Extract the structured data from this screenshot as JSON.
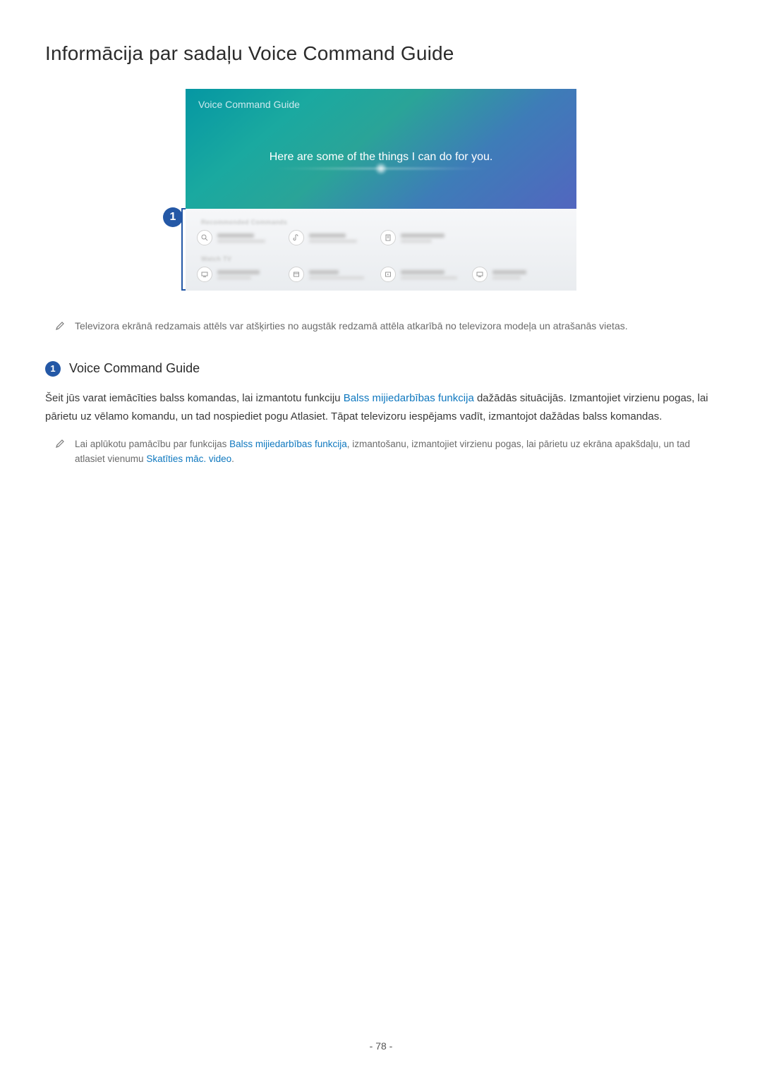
{
  "heading": "Informācija par sadaļu Voice Command Guide",
  "tv": {
    "title": "Voice Command Guide",
    "tagline": "Here are some of the things I can do for you.",
    "section1_label": "Recommended Commands",
    "section2_label": "Watch TV"
  },
  "callout": {
    "num": "1"
  },
  "note1": "Televizora ekrānā redzamais attēls var atšķirties no augstāk redzamā attēla atkarībā no televizora modeļa un atrašanās vietas.",
  "section": {
    "num": "1",
    "title": "Voice Command Guide"
  },
  "body": {
    "p1a": "Šeit jūs varat iemācīties balss komandas, lai izmantotu funkciju ",
    "p1_link": "Balss mijiedarbības funkcija",
    "p1b": " dažādās situācijās. Izmantojiet virzienu pogas, lai pārietu uz vēlamo komandu, un tad nospiediet pogu Atlasiet. Tāpat televizoru iespējams vadīt, izmantojot dažādas balss komandas."
  },
  "note2": {
    "a": "Lai aplūkotu pamācību par funkcijas ",
    "link1": "Balss mijiedarbības funkcija",
    "b": ", izmantošanu, izmantojiet virzienu pogas, lai pārietu uz ekrāna apakšdaļu, un tad atlasiet vienumu ",
    "link2": "Skatīties māc. video",
    "c": "."
  },
  "page_num": "- 78 -"
}
